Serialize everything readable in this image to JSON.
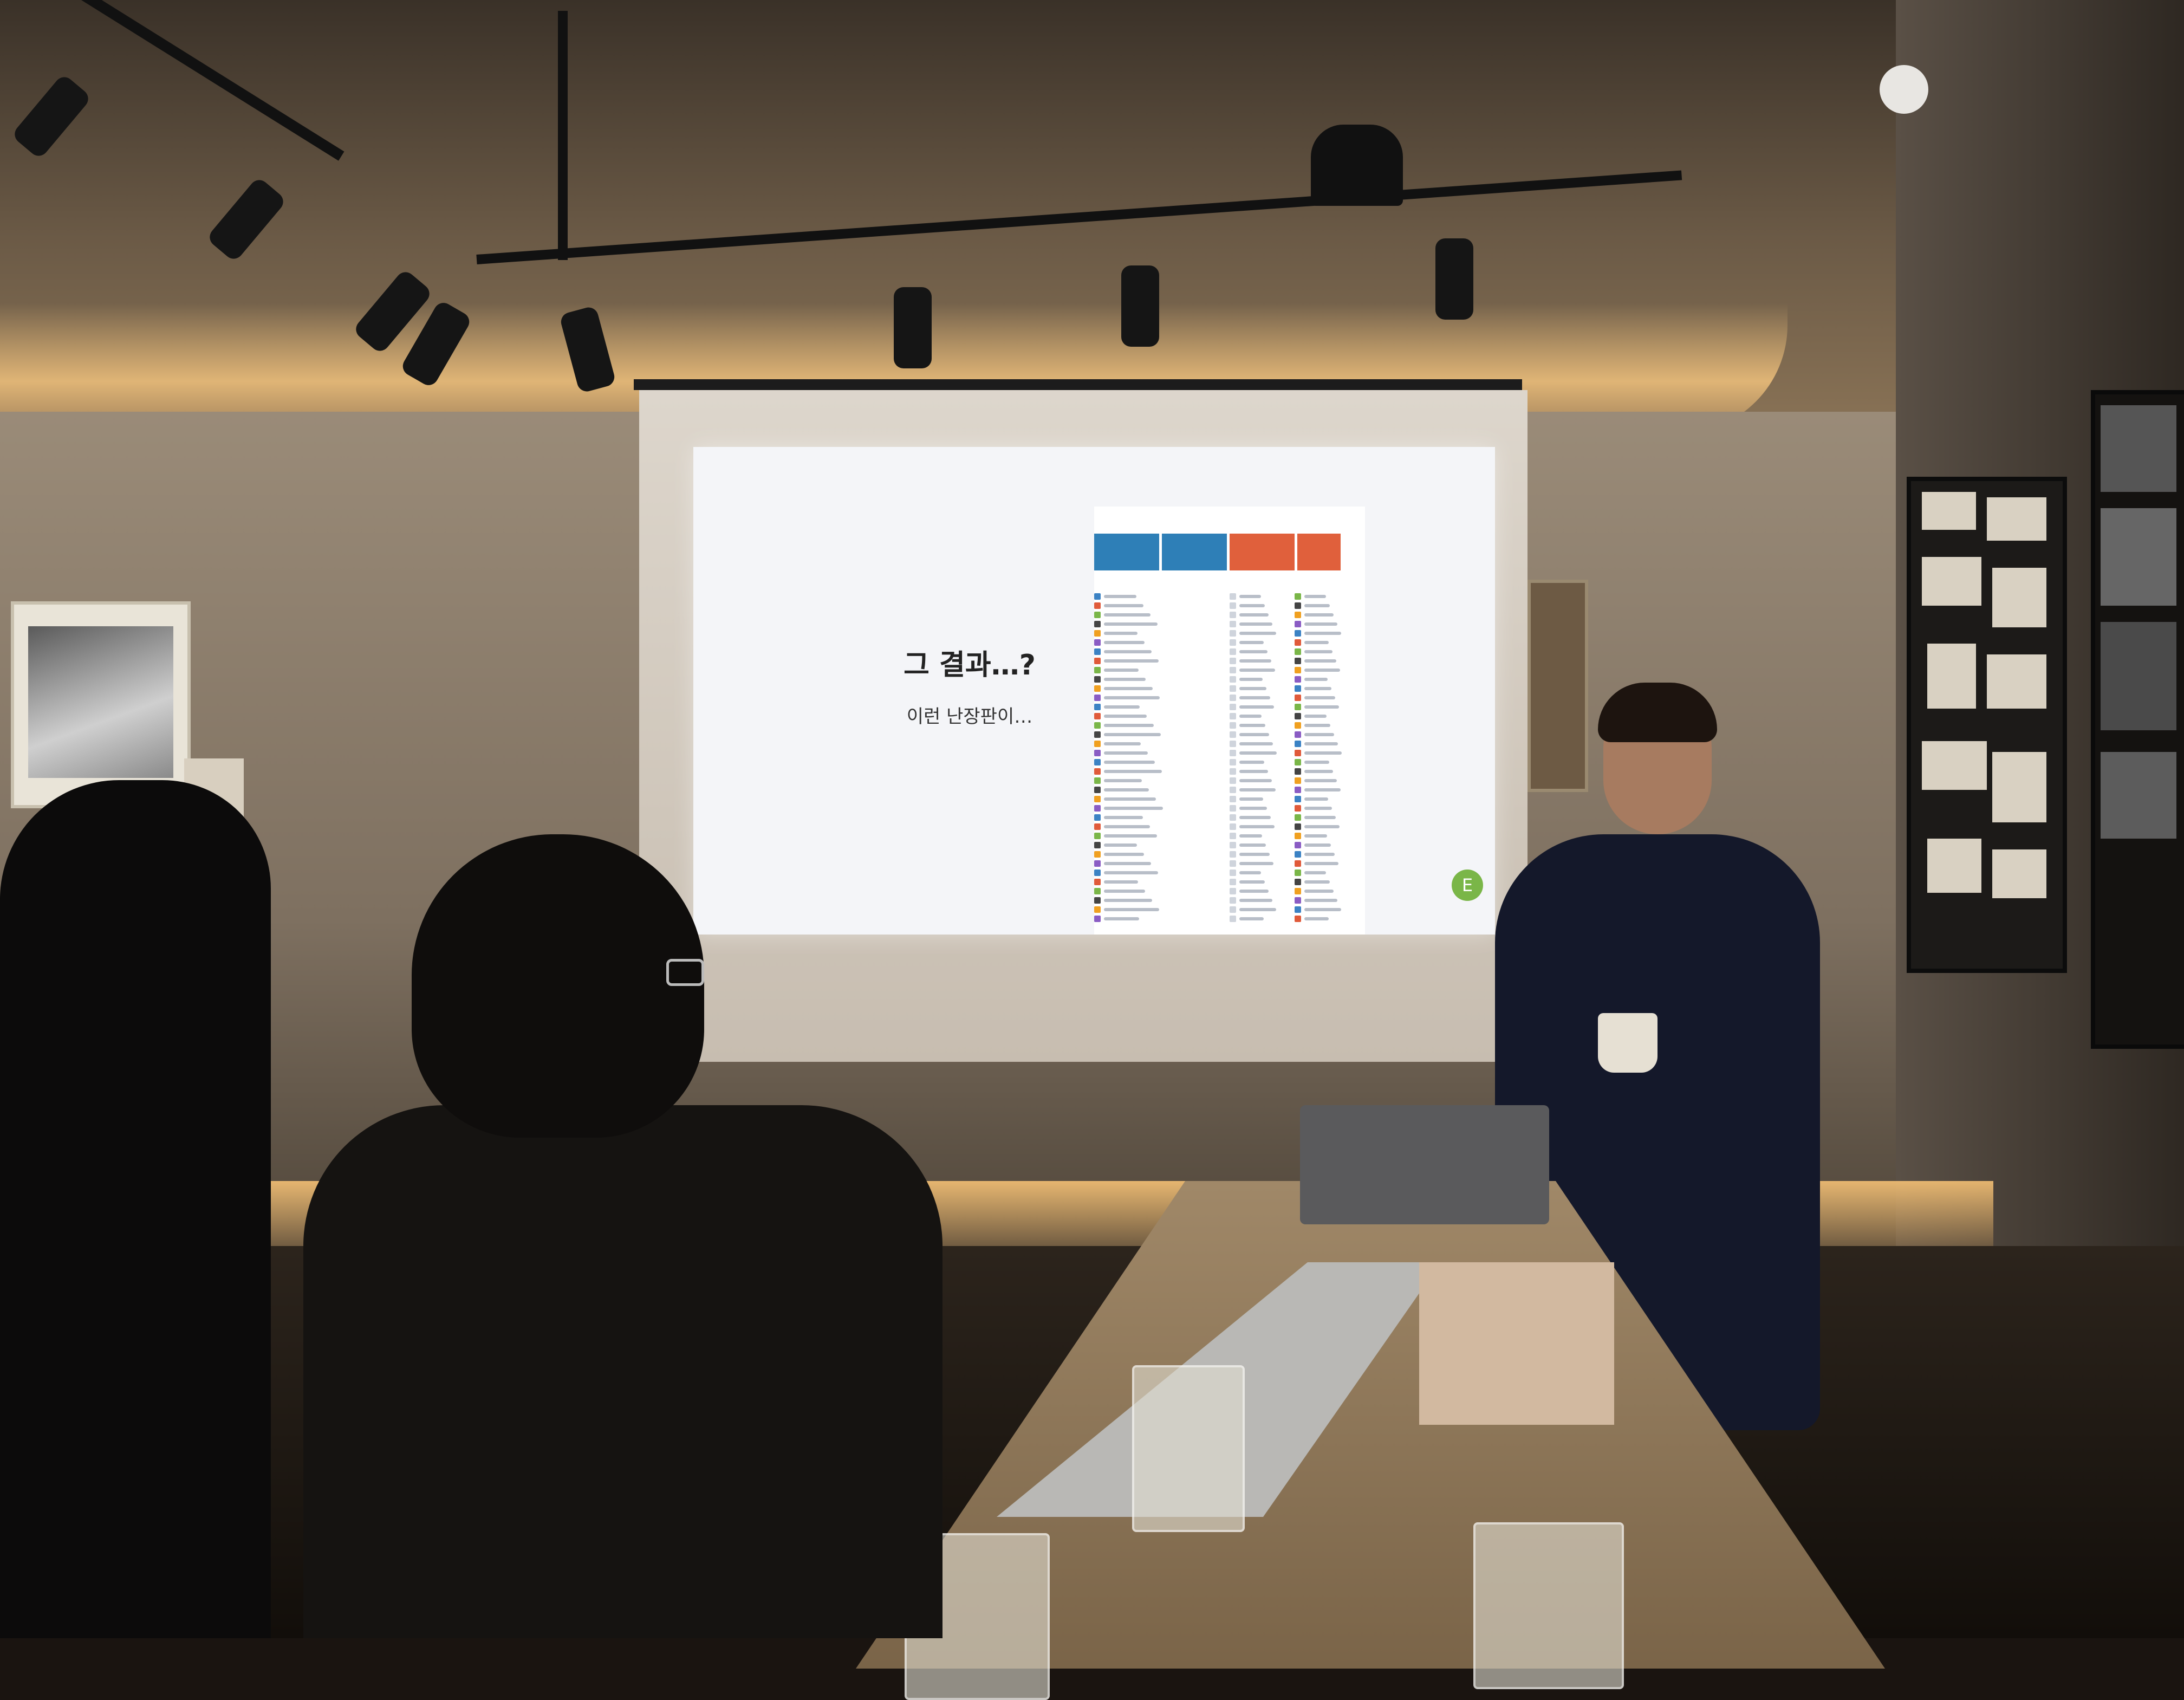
{
  "scene": {
    "type": "presentation in a dimly lit cafe meeting room"
  },
  "slide": {
    "title": "그 결과…?",
    "subtitle": "이런 난장판이…",
    "logo_letter": "E",
    "card_colors": [
      "#2e7fb7",
      "#2e7fb7",
      "#e0603c",
      "#e0603c"
    ],
    "accent_color": "#7ab648"
  }
}
